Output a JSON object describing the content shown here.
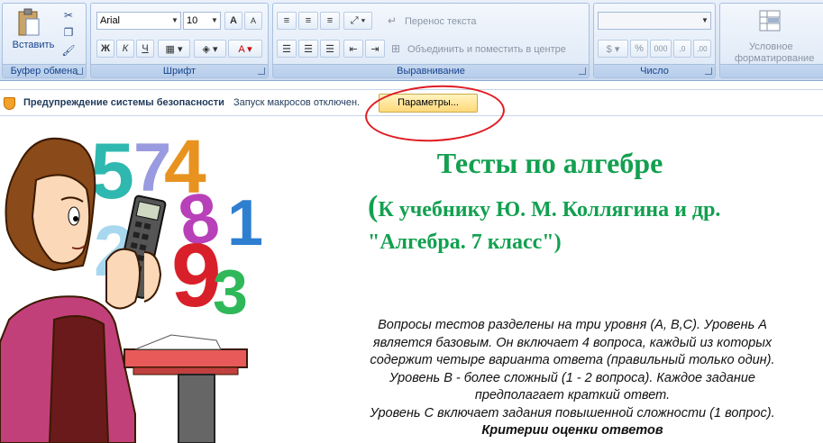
{
  "ribbon": {
    "clipboard": {
      "paste_label": "Вставить",
      "group_label": "Буфер обмена"
    },
    "font": {
      "font_name": "Arial",
      "font_size": "10",
      "bold": "Ж",
      "italic": "К",
      "underline": "Ч",
      "group_label": "Шрифт"
    },
    "alignment": {
      "wrap_text": "Перенос текста",
      "merge_center": "Объединить и поместить в центре",
      "group_label": "Выравнивание"
    },
    "number": {
      "percent": "%",
      "thousands": "000",
      "group_label": "Число"
    },
    "styles": {
      "conditional_line1": "Условное",
      "conditional_line2": "форматирование"
    }
  },
  "security_bar": {
    "title": "Предупреждение системы безопасности",
    "message": "Запуск макросов отключен.",
    "options_button": "Параметры..."
  },
  "content": {
    "title": "Тесты по алгебре",
    "subtitle_line1": "К учебнику Ю. М. Коллягина и др.",
    "subtitle_line2": "\"Алгебра. 7 класс\")",
    "description": [
      "Вопросы тестов разделены на три уровня (А, В,С). Уровень А",
      "является базовым. Он включает 4 вопроса, каждый из которых",
      "содержит четыре варианта ответа (правильный только один).",
      "Уровень В - более сложный (1 - 2 вопроса). Каждое задание",
      "предполагает краткий ответ.",
      "Уровень С включает задания повышенной сложности (1 вопрос)."
    ],
    "criteria": "Критерии оценки ответов",
    "illustration_digits": [
      "5",
      "7",
      "4",
      "2",
      "8",
      "1",
      "9",
      "3"
    ]
  },
  "colors": {
    "title_green": "#12a050",
    "ellipse_red": "#e11b22"
  }
}
